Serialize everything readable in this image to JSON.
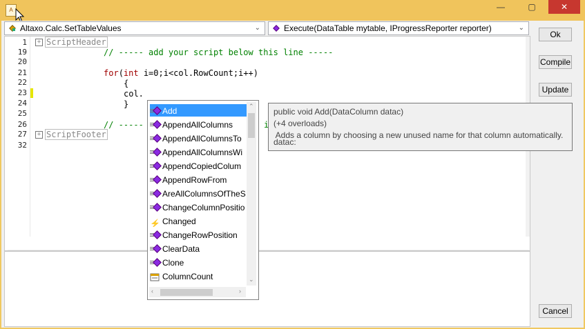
{
  "window": {
    "min_label": "—",
    "max_label": "▢",
    "close_label": "✕"
  },
  "combo_left": {
    "value": "Altaxo.Calc.SetTableValues"
  },
  "combo_right": {
    "value": "Execute(DataTable mytable, IProgressReporter reporter)"
  },
  "editor": {
    "lines": [
      {
        "num": "1"
      },
      {
        "num": "19"
      },
      {
        "num": "20"
      },
      {
        "num": "21"
      },
      {
        "num": "22"
      },
      {
        "num": "23"
      },
      {
        "num": "24"
      },
      {
        "num": "25"
      },
      {
        "num": "26"
      },
      {
        "num": "27"
      },
      {
        "num": "32"
      }
    ],
    "fold_header": "ScriptHeader",
    "fold_footer": "ScriptFooter",
    "comment_add": "// ----- add your script below this line -----",
    "for_kw": "for",
    "for_open": "(",
    "int_kw": "int",
    "for_rest": " i=0;i<col.RowCount;i++)",
    "brace_open": "{",
    "col_stmt": "col.",
    "brace_close": "}",
    "comment_end": "// -----",
    "comment_end_tail": "i"
  },
  "buttons": {
    "ok": "Ok",
    "compile": "Compile",
    "update": "Update",
    "cancel": "Cancel"
  },
  "completion": {
    "items": [
      {
        "label": "Add",
        "icon": "method-icon",
        "selected": true
      },
      {
        "label": "AppendAllColumns",
        "icon": "method-icon"
      },
      {
        "label": "AppendAllColumnsTo",
        "icon": "method-icon"
      },
      {
        "label": "AppendAllColumnsWi",
        "icon": "method-icon"
      },
      {
        "label": "AppendCopiedColum",
        "icon": "method-icon"
      },
      {
        "label": "AppendRowFrom",
        "icon": "method-icon"
      },
      {
        "label": "AreAllColumnsOfTheS",
        "icon": "method-icon"
      },
      {
        "label": "ChangeColumnPositio",
        "icon": "method-icon"
      },
      {
        "label": "Changed",
        "icon": "event-icon"
      },
      {
        "label": "ChangeRowPosition",
        "icon": "method-icon"
      },
      {
        "label": "ClearData",
        "icon": "method-icon"
      },
      {
        "label": "Clone",
        "icon": "method-icon"
      },
      {
        "label": "ColumnCount",
        "icon": "property-icon"
      }
    ]
  },
  "tooltip": {
    "signature": "public void Add(DataColumn datac)",
    "overloads": "(+4 overloads)",
    "description": " Adds a column by choosing a new unused name for that column automatically.",
    "param": "datac:"
  },
  "colors": {
    "title_bar": "#f0c45c",
    "close_button": "#c7372f",
    "selection": "#3399ff",
    "keyword": "#a00000",
    "comment": "#008000"
  }
}
